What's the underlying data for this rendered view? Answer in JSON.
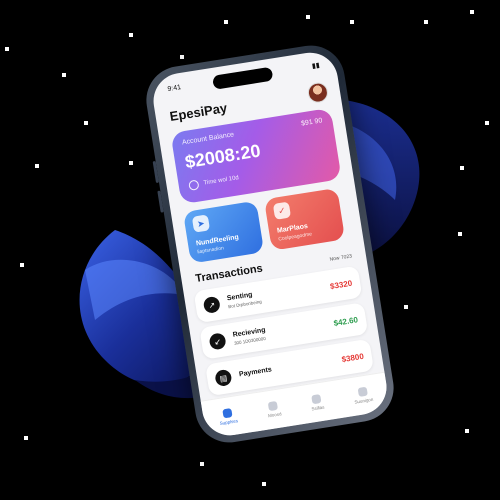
{
  "colors": {
    "background": "#000000",
    "balance_gradient_start": "#7b7bf0",
    "balance_gradient_end": "#e35aa7",
    "tile_blue": "#2f6fe0",
    "tile_red": "#e44f4f",
    "amount_negative": "#e53935",
    "amount_positive": "#2e9d4f",
    "ribbon": "#1f3fb8"
  },
  "status_bar": {
    "time": "9:41"
  },
  "app": {
    "title": "EpesiPay"
  },
  "balance_card": {
    "label": "Account Balance",
    "badge": "$91 90",
    "amount": "$2008:20",
    "footnote": "Time wol 10d"
  },
  "tiles": [
    {
      "label": "NundReeling",
      "sub": "liaptsnadion",
      "icon": "send-icon"
    },
    {
      "label": "MarPlaos",
      "sub": "Coolpeagodme",
      "icon": "receive-icon"
    }
  ],
  "transactions": {
    "title": "Transactions",
    "date": "Now 7023",
    "items": [
      {
        "name": "Senting",
        "sub": "Bot Drpbonbeing",
        "amount": "$3320",
        "kind": "negative",
        "icon": "send-icon"
      },
      {
        "name": "Recieving",
        "sub": "300 1D0300000",
        "amount": "$42.60",
        "kind": "positive",
        "icon": "receive-icon"
      },
      {
        "name": "Payments",
        "sub": "",
        "amount": "$3800",
        "kind": "negative",
        "icon": "payments-icon"
      }
    ]
  },
  "bottom_nav": [
    {
      "label": "Supplses",
      "icon": "home-icon",
      "active": true
    },
    {
      "label": "Moosd",
      "icon": "wallet-icon",
      "active": false
    },
    {
      "label": "Ssillas",
      "icon": "chart-icon",
      "active": false
    },
    {
      "label": "Suunigon",
      "icon": "settings-icon",
      "active": false
    }
  ]
}
